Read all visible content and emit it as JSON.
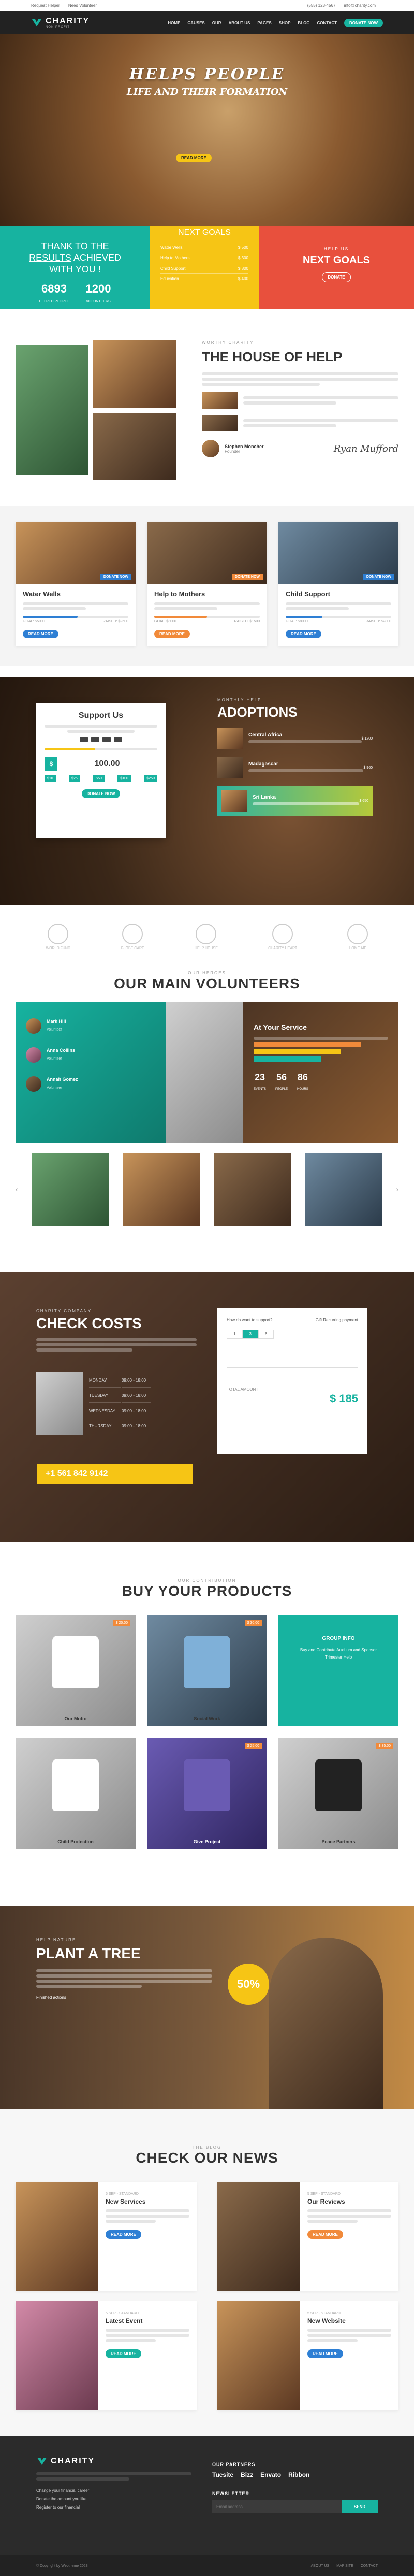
{
  "topbar": {
    "left1": "Request Helper",
    "left2": "Need Volunteer",
    "phone": "(555) 123-4567",
    "email": "info@charity.com"
  },
  "nav": {
    "logo": "CHARITY",
    "tagline": "NON PROFIT",
    "items": [
      "HOME",
      "CAUSES",
      "OUR",
      "ABOUT US",
      "PAGES",
      "SHOP",
      "BLOG",
      "CONTACT"
    ],
    "cta": "DONATE NOW"
  },
  "hero": {
    "title": "HELPS PEOPLE",
    "subtitle": "LIFE AND THEIR FORMATION",
    "button": "READ MORE"
  },
  "stats": {
    "title1": "THANK TO THE",
    "title2": "RESULTS",
    "title3": "ACHIEVED",
    "title4": "WITH YOU !",
    "n1": "6893",
    "n1_label": "HELPED PEOPLE",
    "n2": "1200",
    "n2_label": "VOLUNTEERS",
    "goals_title": "NEXT GOALS",
    "goals": [
      {
        "label": "Water Wells",
        "value": "$ 500"
      },
      {
        "label": "Help to Mothers",
        "value": "$ 300"
      },
      {
        "label": "Child Support",
        "value": "$ 800"
      },
      {
        "label": "Education",
        "value": "$ 400"
      }
    ],
    "help_sub": "HELP US",
    "help_title": "NEXT GOALS",
    "help_btn": "DONATE"
  },
  "house": {
    "sub": "WORTHY CHARITY",
    "title": "THE HOUSE OF HELP",
    "name": "Stephen Moncher",
    "role": "Founder",
    "signature": "Ryan Mufford"
  },
  "causes": [
    {
      "tag": "DONATE NOW",
      "title": "Water Wells",
      "btn": "READ MORE",
      "raised": "GOAL: $5000",
      "pct": "RAISED: $2600"
    },
    {
      "tag": "DONATE NOW",
      "title": "Help to Mothers",
      "btn": "READ MORE",
      "raised": "GOAL: $3000",
      "pct": "RAISED: $1500"
    },
    {
      "tag": "DONATE NOW",
      "title": "Child Support",
      "btn": "READ MORE",
      "raised": "GOAL: $8000",
      "pct": "RAISED: $2800"
    }
  ],
  "support": {
    "title": "Support Us",
    "amount": "100.00",
    "currency": "$",
    "presets": [
      "$10",
      "$25",
      "$50",
      "$100",
      "$250"
    ],
    "btn": "DONATE NOW"
  },
  "adoptions": {
    "sub": "MONTHLY HELP",
    "title": "ADOPTIONS",
    "items": [
      {
        "name": "Central Africa",
        "amount": "$ 1200"
      },
      {
        "name": "Madagascar",
        "amount": "$ 960"
      },
      {
        "name": "Sri Lanka",
        "amount": "$ 650"
      }
    ]
  },
  "partners": [
    "WORLD FUND",
    "GLOBE CARE",
    "HELP HOUSE",
    "CHARITY HEART",
    "HOME AID"
  ],
  "volunteers": {
    "sub": "OUR HEROES",
    "title": "OUR MAIN VOLUNTEERS",
    "people": [
      {
        "name": "Mark Hill",
        "role": "Volunteer"
      },
      {
        "name": "Anna Collins",
        "role": "Volunteer"
      },
      {
        "name": "Annah Gomez",
        "role": "Volunteer"
      }
    ],
    "service_title": "At Your Service",
    "counts": [
      {
        "n": "23",
        "l": "EVENTS"
      },
      {
        "n": "56",
        "l": "PEOPLE"
      },
      {
        "n": "86",
        "l": "HOURS"
      }
    ]
  },
  "costs": {
    "sub": "CHARITY COMPANY",
    "title": "CHECK COSTS",
    "schedule": [
      {
        "day": "MONDAY",
        "time": "09:00 - 18:00"
      },
      {
        "day": "TUESDAY",
        "time": "09:00 - 18:00"
      },
      {
        "day": "WEDNESDAY",
        "time": "09:00 - 18:00"
      },
      {
        "day": "THURSDAY",
        "time": "09:00 - 18:00"
      }
    ],
    "phone": "+1 561 842 9142",
    "calc_q1": "How do want to support?",
    "calc_q2": "Gift Recurring payment",
    "seg": [
      "1",
      "3",
      "6"
    ],
    "total": "$ 185",
    "total_label": "TOTAL AMOUNT"
  },
  "products": {
    "sub": "OUR CONTRIBUTION",
    "title": "BUY YOUR PRODUCTS",
    "items": [
      {
        "label": "Our Motto",
        "price": "$ 20.00"
      },
      {
        "label": "Social Work",
        "price": "$ 30.00"
      },
      {
        "label": "GROUP INFO",
        "promo": "Buy and Contribute Auxilium and Sponsor Trimester Help"
      },
      {
        "label": "Child Protection",
        "price": ""
      },
      {
        "label": "Give Project",
        "price": "$ 25.00"
      },
      {
        "label": "Peace Partners",
        "price": "$ 35.00"
      }
    ]
  },
  "tree": {
    "sub": "HELP NATURE",
    "title": "PLANT A TREE",
    "pct": "50%",
    "label": "Finished actions"
  },
  "news": {
    "sub": "THE BLOG",
    "title": "CHECK OUR NEWS",
    "posts": [
      {
        "meta": "5 SEP - STANDARD",
        "title": "New Services",
        "btn": "READ MORE"
      },
      {
        "meta": "5 SEP - STANDARD",
        "title": "Our Reviews",
        "btn": "READ MORE"
      },
      {
        "meta": "5 SEP - STANDARD",
        "title": "Latest Event",
        "btn": "READ MORE"
      },
      {
        "meta": "5 SEP - STANDARD",
        "title": "New Website",
        "btn": "READ MORE"
      }
    ]
  },
  "footer": {
    "logo": "CHARITY",
    "partners_title": "OUR PARTNERS",
    "partners": [
      "Tuesite",
      "Bizz",
      "Envato",
      "Ribbon"
    ],
    "newsletter_title": "NEWSLETTER",
    "newsletter_placeholder": "Email address",
    "newsletter_btn": "SEND",
    "links": [
      "Change your financial career",
      "Donate the amount you like",
      "Register to our financial"
    ],
    "copyright": "© Copyright by Webtheme 2023",
    "bottom": [
      "ABOUT US",
      "MAP SITE",
      "CONTACT"
    ]
  }
}
